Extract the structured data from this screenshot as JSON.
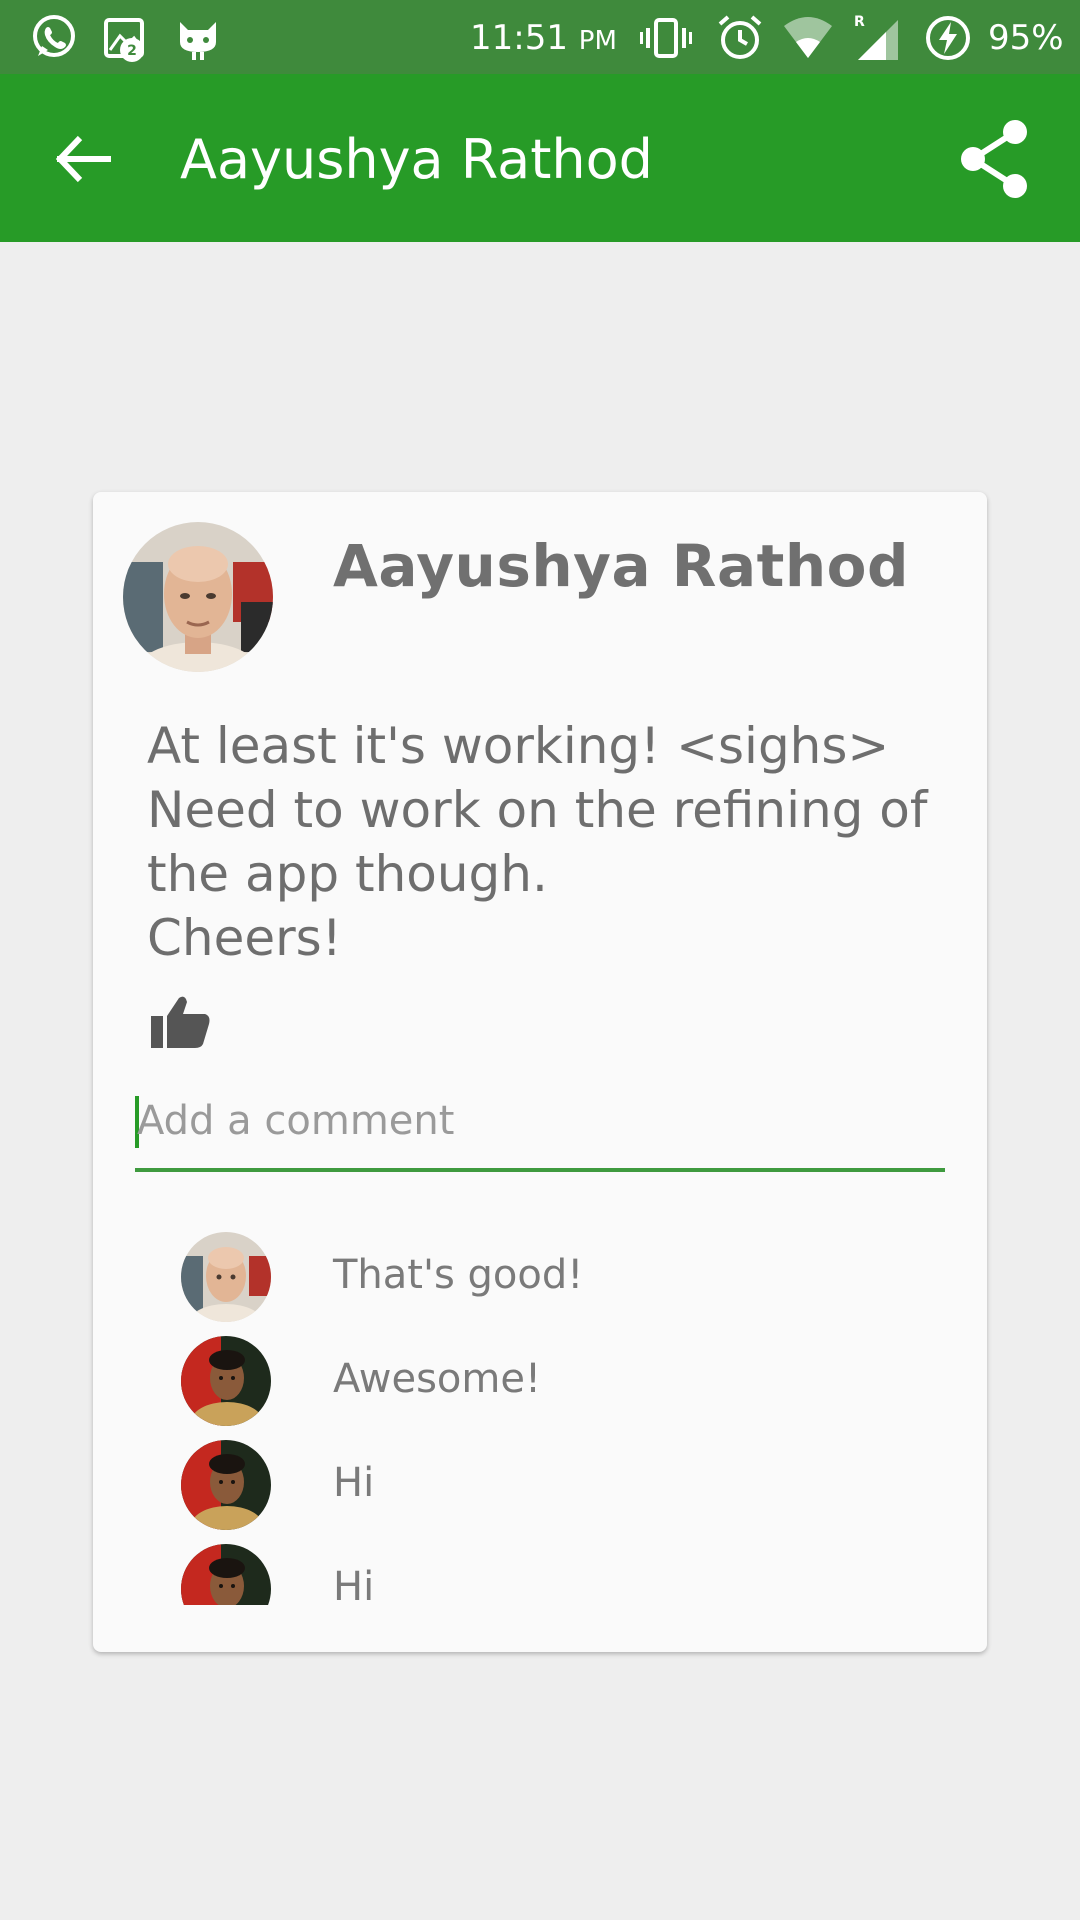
{
  "status_bar": {
    "time": "11:51",
    "time_suffix": "PM",
    "notification_badge": "2",
    "battery": "95%",
    "icons": [
      "whatsapp-icon",
      "gallery-notification-icon",
      "android-cat-icon",
      "vibrate-icon",
      "alarm-icon",
      "wifi-icon",
      "signal-icon",
      "battery-charging-icon"
    ]
  },
  "app_bar": {
    "title": "Aayushya Rathod",
    "back_icon": "arrow-left-icon",
    "share_icon": "share-icon"
  },
  "post": {
    "author": "Aayushya Rathod",
    "text": "At least it's working! <sighs>\nNeed to work on the refining of the app though.\nCheers!",
    "like_icon": "thumbs-up-icon",
    "comment_placeholder": "Add a comment"
  },
  "comments": [
    {
      "text": "That's good!",
      "avatar": "bald-man-avatar"
    },
    {
      "text": "Awesome!",
      "avatar": "young-man-avatar"
    },
    {
      "text": "Hi",
      "avatar": "young-man-avatar"
    },
    {
      "text": "Hi",
      "avatar": "young-man-avatar"
    }
  ],
  "colors": {
    "status_bar": "#3f8a3c",
    "app_bar": "#279b27",
    "background": "#eeeeee",
    "card": "#fafafa",
    "accent_underline": "#3f9a3f"
  }
}
